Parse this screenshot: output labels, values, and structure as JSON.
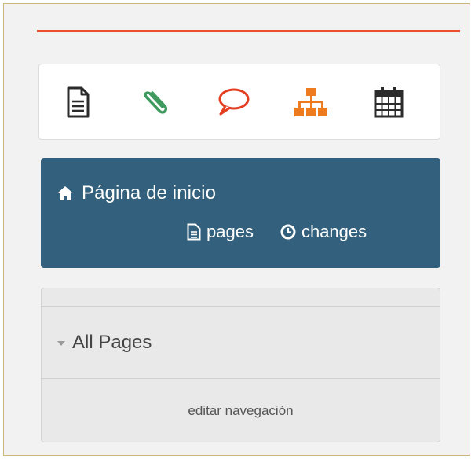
{
  "colors": {
    "accent_line": "#e8512b",
    "wiki_card_bg": "#33617d",
    "icon_blue": "#2e6fa8",
    "icon_green": "#3e9a5f",
    "icon_red": "#e43f23",
    "icon_orange": "#ef7b1f",
    "icon_dark": "#2b2b2b"
  },
  "toolbar": {
    "icons": [
      "document-icon",
      "paperclip-icon",
      "speech-bubble-icon",
      "sitemap-icon",
      "calendar-icon"
    ]
  },
  "wiki": {
    "home_label": "Página de inicio",
    "pages_label": "pages",
    "changes_label": "changes"
  },
  "navigation": {
    "all_pages_label": "All Pages",
    "edit_label": "editar navegación"
  }
}
